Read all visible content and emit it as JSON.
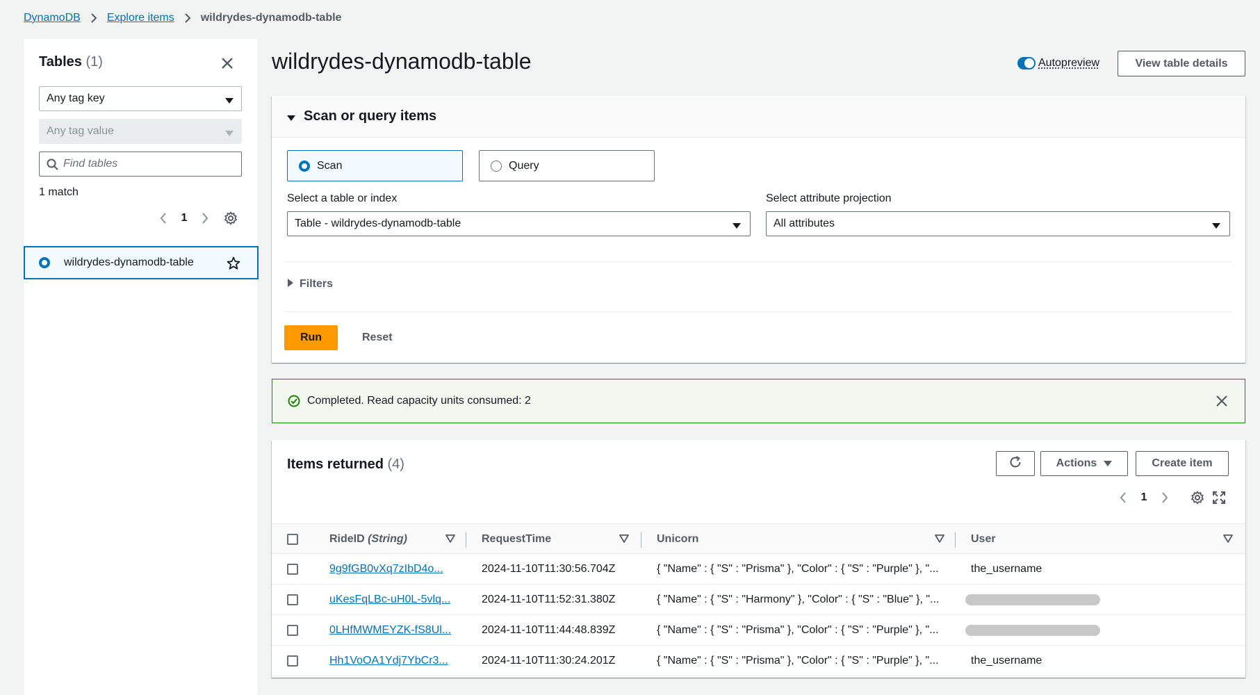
{
  "breadcrumb": {
    "items": [
      "DynamoDB",
      "Explore items"
    ],
    "current": "wildrydes-dynamodb-table"
  },
  "left_panel": {
    "title": "Tables",
    "count": "(1)",
    "tag_key_select": "Any tag key",
    "tag_value_select": "Any tag value",
    "search_placeholder": "Find tables",
    "match_text": "1 match",
    "page": "1",
    "table_name": "wildrydes-dynamodb-table"
  },
  "header": {
    "title": "wildrydes-dynamodb-table",
    "autopreview_label": "Autopreview",
    "view_details_label": "View table details"
  },
  "scan_panel": {
    "title": "Scan or query items",
    "scan_label": "Scan",
    "query_label": "Query",
    "table_index_label": "Select a table or index",
    "table_index_value": "Table - wildrydes-dynamodb-table",
    "projection_label": "Select attribute projection",
    "projection_value": "All attributes",
    "filters_label": "Filters",
    "run_label": "Run",
    "reset_label": "Reset"
  },
  "flash": {
    "message": "Completed. Read capacity units consumed: 2"
  },
  "items": {
    "title": "Items returned",
    "count": "(4)",
    "actions_label": "Actions",
    "create_label": "Create item",
    "page": "1",
    "columns": {
      "ride_id": "RideID",
      "ride_id_type": "(String)",
      "request_time": "RequestTime",
      "unicorn": "Unicorn",
      "user": "User"
    },
    "rows": [
      {
        "ride_id": "9g9fGB0vXq7zIbD4o...",
        "request_time": "2024-11-10T11:30:56.704Z",
        "unicorn": "{ \"Name\" : { \"S\" : \"Prisma\" }, \"Color\" : { \"S\" : \"Purple\" }, \"...",
        "user": "the_username"
      },
      {
        "ride_id": "uKesFqLBc-uH0L-5vlq...",
        "request_time": "2024-11-10T11:52:31.380Z",
        "unicorn": "{ \"Name\" : { \"S\" : \"Harmony\" }, \"Color\" : { \"S\" : \"Blue\" }, \"...",
        "user": ""
      },
      {
        "ride_id": "0LHfMWMEYZK-fS8Ul...",
        "request_time": "2024-11-10T11:44:48.839Z",
        "unicorn": "{ \"Name\" : { \"S\" : \"Prisma\" }, \"Color\" : { \"S\" : \"Purple\" }, \"...",
        "user": ""
      },
      {
        "ride_id": "Hh1VoOA1Ydj7YbCr3...",
        "request_time": "2024-11-10T11:30:24.201Z",
        "unicorn": "{ \"Name\" : { \"S\" : \"Prisma\" }, \"Color\" : { \"S\" : \"Purple\" }, \"...",
        "user": "the_username"
      }
    ]
  },
  "colors": {
    "link": "#0073bb",
    "run_button": "#ff9900",
    "success": "#1d8102",
    "selected_bg": "#f1faff"
  },
  "icons": [
    "chevron-right-icon",
    "close-icon",
    "caret-down-icon",
    "search-icon",
    "chevron-left-icon",
    "gear-icon",
    "star-icon",
    "triangle-down-icon",
    "triangle-right-icon",
    "check-circle-icon",
    "refresh-icon",
    "expand-icon",
    "sort-icon"
  ]
}
